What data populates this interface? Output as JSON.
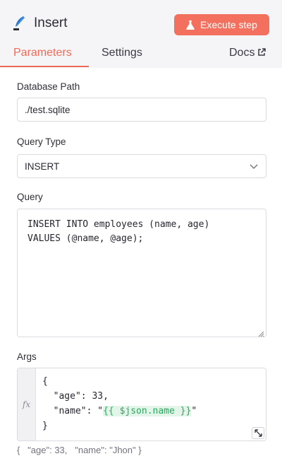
{
  "header": {
    "node_icon": "feather-quill-icon",
    "title": "Insert",
    "execute_label": "Execute step",
    "execute_icon": "flask-icon",
    "accent_color": "#f3705f"
  },
  "tabs": {
    "parameters": "Parameters",
    "settings": "Settings",
    "docs": "Docs",
    "docs_icon": "external-link-icon",
    "active": "parameters"
  },
  "fields": {
    "database_path": {
      "label": "Database Path",
      "value": "./test.sqlite"
    },
    "query_type": {
      "label": "Query Type",
      "value": "INSERT",
      "icon": "chevron-down-icon"
    },
    "query": {
      "label": "Query",
      "lines": [
        "INSERT INTO employees (name, age)",
        "VALUES (@name, @age);"
      ]
    },
    "args": {
      "label": "Args",
      "fx_label": "fx",
      "line1": "{",
      "line2": "  \"age\": 33,",
      "line3_prefix": "  \"name\": \"",
      "line3_expression": "{{ $json.name }}",
      "line3_suffix": "\"",
      "line4": "}",
      "preview": "{   \"age\": 33,   \"name\": \"Jhon\" }"
    }
  }
}
